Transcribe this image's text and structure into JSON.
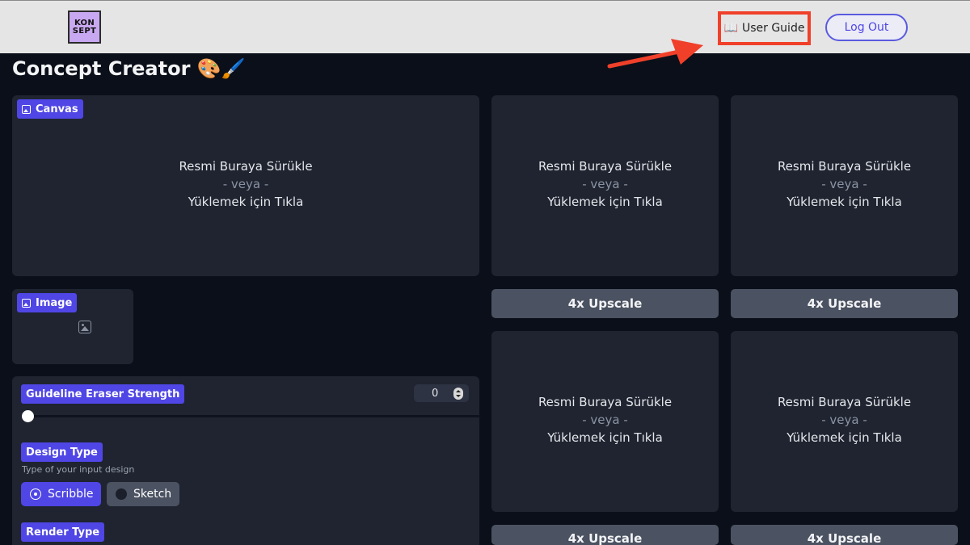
{
  "header": {
    "logo_line1": "KON",
    "logo_line2": "SEPT",
    "user_guide_icon": "📖",
    "user_guide_label": "User Guide",
    "logout_label": "Log Out"
  },
  "page": {
    "title": "Concept Creator 🎨🖌️"
  },
  "canvas_panel": {
    "label": "Canvas",
    "drop_main": "Resmi Buraya Sürükle",
    "drop_or": "- veya -",
    "drop_click": "Yüklemek için Tıkla"
  },
  "image_panel": {
    "label": "Image"
  },
  "outputs": [
    {
      "drop_main": "Resmi Buraya Sürükle",
      "drop_or": "- veya -",
      "drop_click": "Yüklemek için Tıkla",
      "upscale_label": "4x Upscale"
    },
    {
      "drop_main": "Resmi Buraya Sürükle",
      "drop_or": "- veya -",
      "drop_click": "Yüklemek için Tıkla",
      "upscale_label": "4x Upscale"
    },
    {
      "drop_main": "Resmi Buraya Sürükle",
      "drop_or": "- veya -",
      "drop_click": "Yüklemek için Tıkla",
      "upscale_label": "4x Upscale"
    },
    {
      "drop_main": "Resmi Buraya Sürükle",
      "drop_or": "- veya -",
      "drop_click": "Yüklemek için Tıkla",
      "upscale_label": "4x Upscale"
    }
  ],
  "controls": {
    "eraser_label": "Guideline Eraser Strength",
    "eraser_value": "0",
    "eraser_fraction": 0,
    "design_type_label": "Design Type",
    "design_type_hint": "Type of your input design",
    "design_options": [
      {
        "label": "Scribble",
        "selected": true
      },
      {
        "label": "Sketch",
        "selected": false
      }
    ],
    "render_type_label": "Render Type"
  },
  "colors": {
    "accent": "#4f46e5",
    "highlight_annotation": "#f0402a",
    "background": "#0b0f19",
    "panel": "#1f2430"
  },
  "icons": {
    "image": "image-icon",
    "arrow": "annotation-arrow-icon"
  }
}
